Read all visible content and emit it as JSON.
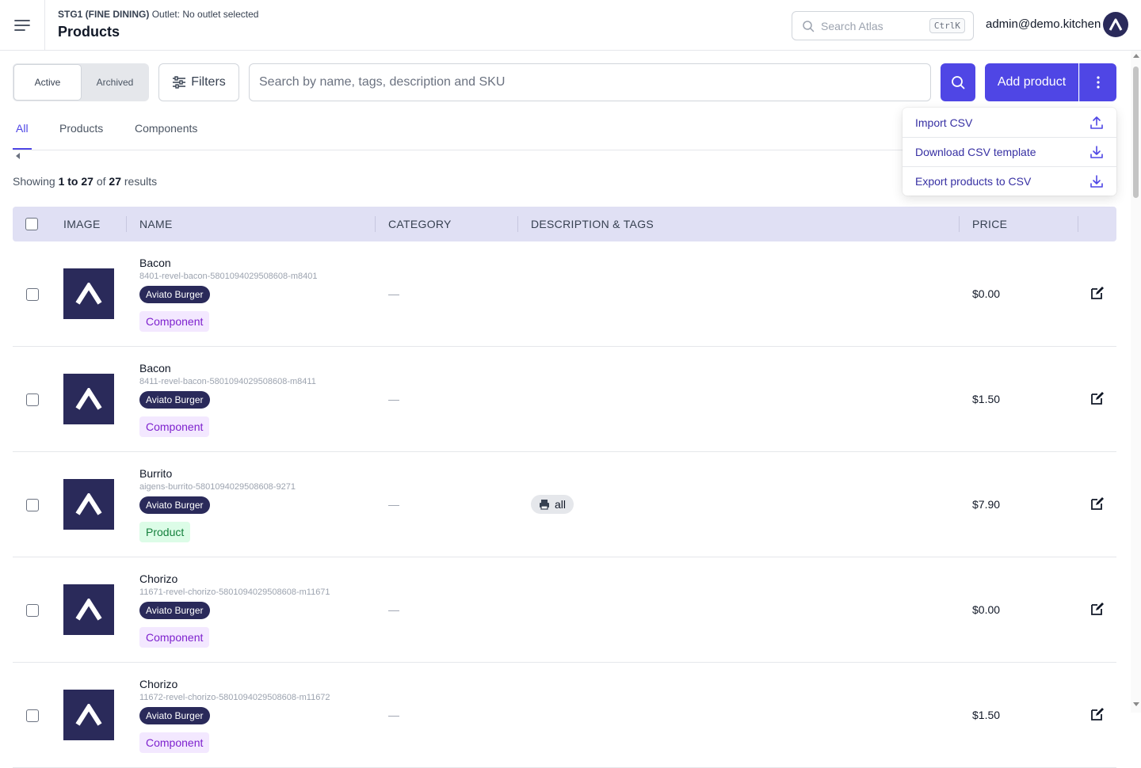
{
  "header": {
    "outlet_name": "STG1 (FINE DINING)",
    "outlet_status": "Outlet: No outlet selected",
    "title": "Products",
    "search_placeholder": "Search Atlas",
    "search_shortcut": "CtrlK",
    "user_email": "admin@demo.kitchen"
  },
  "toolbar": {
    "segment": [
      {
        "label": "Active",
        "selected": true
      },
      {
        "label": "Archived",
        "selected": false
      }
    ],
    "filters_label": "Filters",
    "search_placeholder": "Search by name, tags, description and SKU",
    "add_label": "Add product"
  },
  "dropdown": {
    "items": [
      {
        "label": "Import CSV",
        "icon": "upload-icon"
      },
      {
        "label": "Download CSV template",
        "icon": "download-icon"
      },
      {
        "label": "Export products to CSV",
        "icon": "download-icon"
      }
    ]
  },
  "tabs": [
    {
      "label": "All",
      "active": true
    },
    {
      "label": "Products",
      "active": false
    },
    {
      "label": "Components",
      "active": false
    }
  ],
  "results": {
    "prefix": "Showing",
    "range": "1 to 27",
    "of": "of",
    "total": "27",
    "suffix": "results"
  },
  "table": {
    "columns": [
      "IMAGE",
      "NAME",
      "CATEGORY",
      "DESCRIPTION & TAGS",
      "PRICE"
    ],
    "rows": [
      {
        "name": "Bacon",
        "sku": "8401-revel-bacon-5801094029508608-m8401",
        "brand": "Aviato Burger",
        "type": "Component",
        "category": "—",
        "tag": "",
        "price": "$0.00"
      },
      {
        "name": "Bacon",
        "sku": "8411-revel-bacon-5801094029508608-m8411",
        "brand": "Aviato Burger",
        "type": "Component",
        "category": "—",
        "tag": "",
        "price": "$1.50"
      },
      {
        "name": "Burrito",
        "sku": "aigens-burrito-5801094029508608-9271",
        "brand": "Aviato Burger",
        "type": "Product",
        "category": "—",
        "tag": "all",
        "price": "$7.90"
      },
      {
        "name": "Chorizo",
        "sku": "11671-revel-chorizo-5801094029508608-m11671",
        "brand": "Aviato Burger",
        "type": "Component",
        "category": "—",
        "tag": "",
        "price": "$0.00"
      },
      {
        "name": "Chorizo",
        "sku": "11672-revel-chorizo-5801094029508608-m11672",
        "brand": "Aviato Burger",
        "type": "Component",
        "category": "—",
        "tag": "",
        "price": "$1.50"
      }
    ]
  },
  "colors": {
    "accent": "#4f46e5",
    "brand_dark": "#2a2a5a",
    "header_bg": "#e0e0f4"
  }
}
